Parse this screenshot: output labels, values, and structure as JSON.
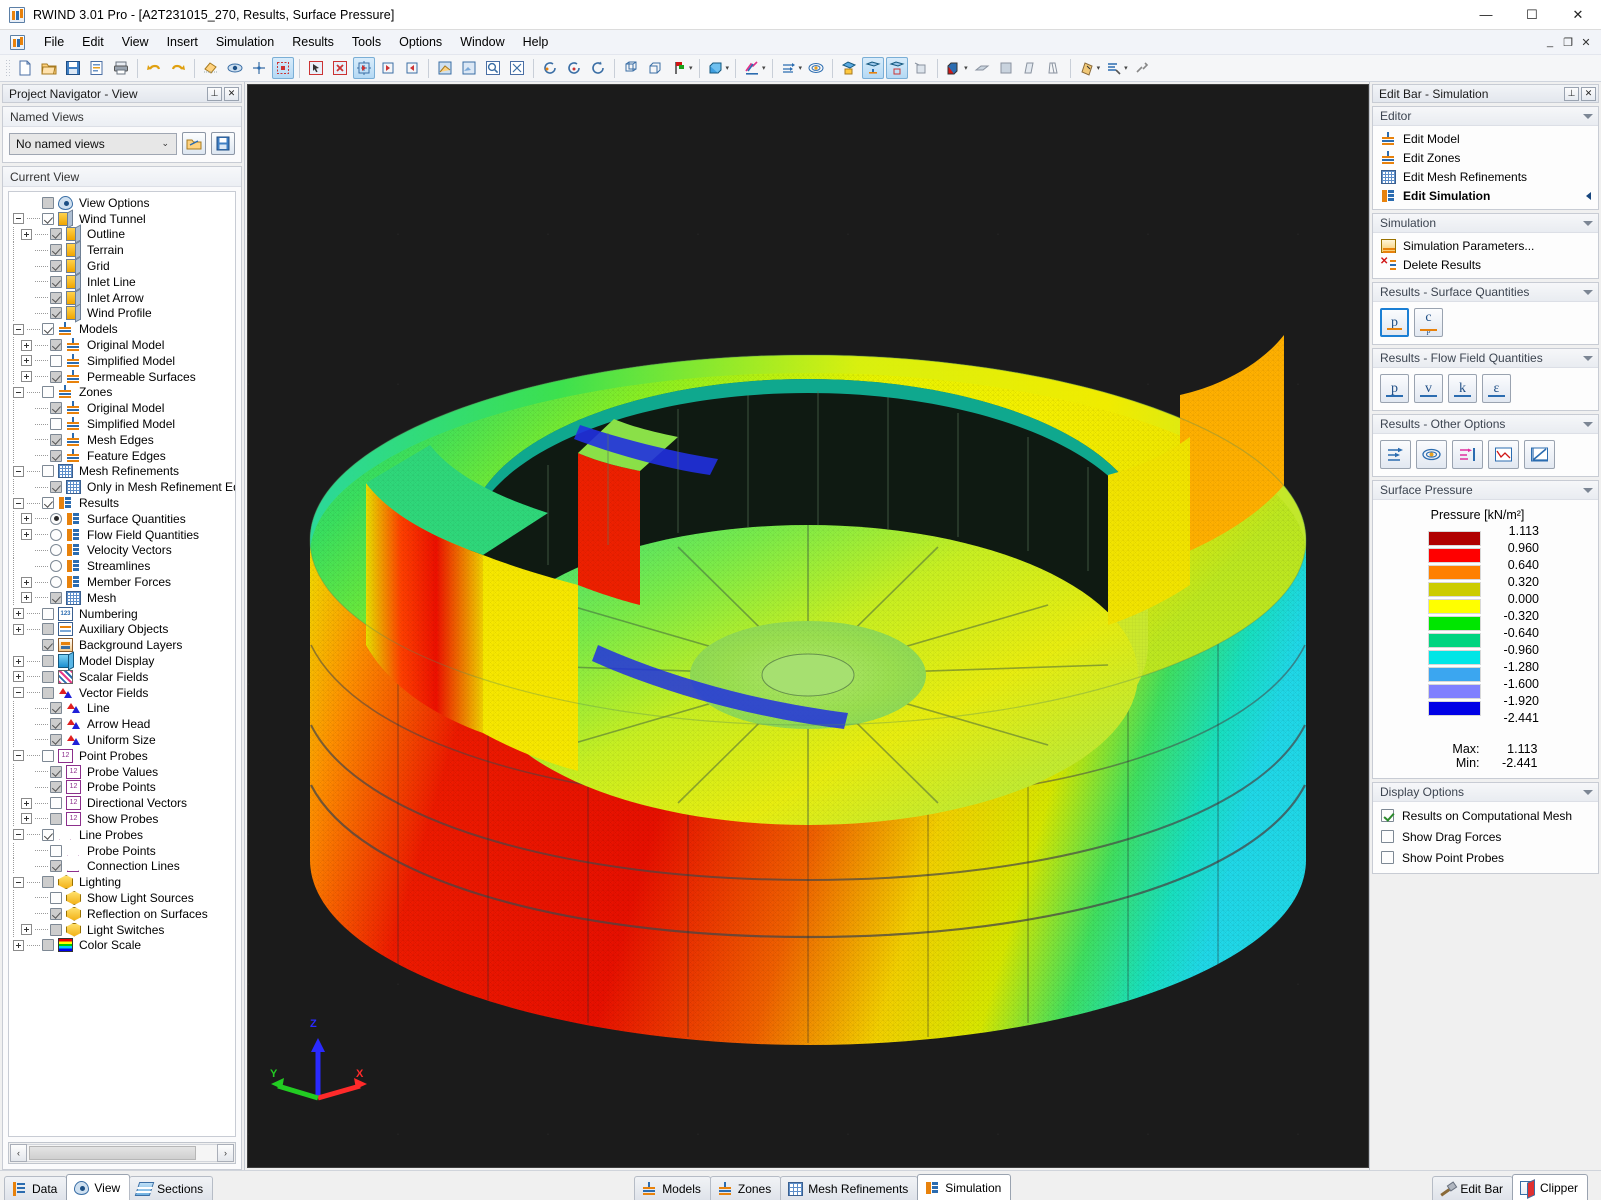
{
  "window": {
    "title": "RWIND 3.01 Pro - [A2T231015_270, Results, Surface Pressure]",
    "minimize": "—",
    "maximize": "☐",
    "close": "✕",
    "mdi_restore": "❐",
    "mdi_minimize": "_",
    "mdi_close": "✕"
  },
  "menu": {
    "items": [
      "File",
      "Edit",
      "View",
      "Insert",
      "Simulation",
      "Results",
      "Tools",
      "Options",
      "Window",
      "Help"
    ]
  },
  "toolbar": {
    "groups": [
      [
        "new-file-icon",
        "open-folder-icon",
        "save-icon",
        "print-preview-icon",
        "print-icon"
      ],
      [
        "undo-icon",
        "redo-icon"
      ],
      [
        "render-mode-icon",
        "view-eye-icon",
        "snap-grid-icon",
        "selection-box-icon"
      ],
      [
        "select-pointer-icon",
        "deselect-icon",
        "rotate-view-icon",
        "rotate-view-2-icon",
        "rotate-view-3-icon"
      ],
      [
        "pan-icon",
        "zoom-window-icon",
        "zoom-region-icon",
        "zoom-fit-icon",
        "zoom-all-icon"
      ],
      [
        "rotate-left-icon",
        "rotate-right-icon",
        "refresh-icon"
      ],
      [
        "wireframe-icon",
        "perspective-icon",
        "axes-flag-icon"
      ],
      [
        "box-view-icon"
      ],
      [
        "scalar-field-icon"
      ],
      [
        "vector-arrows-icon",
        "streamline-icon"
      ],
      [
        "result-surface-icon",
        "result-model-icon",
        "result-box-icon",
        "result-dim-icon"
      ],
      [
        "color-cube-icon",
        "plane-icon",
        "solid-icon",
        "section-icon",
        "clip-icon"
      ],
      [
        "measure-icon",
        "tools-icon",
        "settings-icon"
      ]
    ]
  },
  "left_panel": {
    "caption": "Project Navigator - View",
    "pin_glyph": "⊥",
    "close_glyph": "✕",
    "named_views": {
      "header": "Named Views",
      "selected": "No named views",
      "chevron": "⌄",
      "buttons": [
        "manage-views-icon",
        "save-view-icon"
      ]
    },
    "current_view": {
      "header": "Current View"
    },
    "tree": [
      {
        "depth": 0,
        "label": "View Options",
        "expander": "none",
        "box": "square-gray",
        "icon": "eye-icon"
      },
      {
        "depth": 0,
        "label": "Wind Tunnel",
        "expander": "minus",
        "box": "checked",
        "icon": "cube-icon"
      },
      {
        "depth": 1,
        "label": "Outline",
        "expander": "plus",
        "box": "checked-gray",
        "icon": "cube-icon"
      },
      {
        "depth": 1,
        "label": "Terrain",
        "expander": "none",
        "box": "checked-gray",
        "icon": "cube-icon"
      },
      {
        "depth": 1,
        "label": "Grid",
        "expander": "none",
        "box": "checked-gray",
        "icon": "cube-icon"
      },
      {
        "depth": 1,
        "label": "Inlet Line",
        "expander": "none",
        "box": "checked-gray",
        "icon": "cube-icon"
      },
      {
        "depth": 1,
        "label": "Inlet Arrow",
        "expander": "none",
        "box": "checked-gray",
        "icon": "cube-icon"
      },
      {
        "depth": 1,
        "label": "Wind Profile",
        "expander": "none",
        "box": "checked-gray",
        "icon": "cube-icon"
      },
      {
        "depth": 0,
        "label": "Models",
        "expander": "minus",
        "box": "checked",
        "icon": "support-icon"
      },
      {
        "depth": 1,
        "label": "Original Model",
        "expander": "plus",
        "box": "checked-gray",
        "icon": "support-icon"
      },
      {
        "depth": 1,
        "label": "Simplified Model",
        "expander": "plus",
        "box": "unchecked",
        "icon": "support-icon"
      },
      {
        "depth": 1,
        "label": "Permeable Surfaces",
        "expander": "plus",
        "box": "checked-gray",
        "icon": "support-icon"
      },
      {
        "depth": 0,
        "label": "Zones",
        "expander": "minus",
        "box": "unchecked",
        "icon": "support-icon"
      },
      {
        "depth": 1,
        "label": "Original Model",
        "expander": "none",
        "box": "checked-gray",
        "icon": "support-icon"
      },
      {
        "depth": 1,
        "label": "Simplified Model",
        "expander": "none",
        "box": "unchecked",
        "icon": "support-icon"
      },
      {
        "depth": 1,
        "label": "Mesh Edges",
        "expander": "none",
        "box": "checked-gray",
        "icon": "support-icon"
      },
      {
        "depth": 1,
        "label": "Feature Edges",
        "expander": "none",
        "box": "checked-gray",
        "icon": "support-icon"
      },
      {
        "depth": 0,
        "label": "Mesh Refinements",
        "expander": "minus",
        "box": "unchecked",
        "icon": "grid-icon"
      },
      {
        "depth": 1,
        "label": "Only in Mesh Refinement Edito",
        "expander": "none",
        "box": "checked-gray",
        "icon": "grid-icon"
      },
      {
        "depth": 0,
        "label": "Results",
        "expander": "minus",
        "box": "checked",
        "icon": "results-icon"
      },
      {
        "depth": 1,
        "label": "Surface Quantities",
        "expander": "plus",
        "box": "radio-on",
        "icon": "results-icon"
      },
      {
        "depth": 1,
        "label": "Flow Field Quantities",
        "expander": "plus",
        "box": "radio-off",
        "icon": "results-icon"
      },
      {
        "depth": 1,
        "label": "Velocity Vectors",
        "expander": "none",
        "box": "radio-off",
        "icon": "results-icon"
      },
      {
        "depth": 1,
        "label": "Streamlines",
        "expander": "none",
        "box": "radio-off",
        "icon": "results-icon"
      },
      {
        "depth": 1,
        "label": "Member Forces",
        "expander": "plus",
        "box": "radio-off",
        "icon": "results-icon"
      },
      {
        "depth": 1,
        "label": "Mesh",
        "expander": "plus",
        "box": "checked-gray",
        "icon": "grid-icon"
      },
      {
        "depth": 0,
        "label": "Numbering",
        "expander": "plus",
        "box": "unchecked",
        "icon": "numbering-icon"
      },
      {
        "depth": 0,
        "label": "Auxiliary Objects",
        "expander": "plus",
        "box": "square-gray",
        "icon": "aux-icon"
      },
      {
        "depth": 0,
        "label": "Background Layers",
        "expander": "none",
        "box": "checked-gray",
        "icon": "layers-icon"
      },
      {
        "depth": 0,
        "label": "Model Display",
        "expander": "plus",
        "box": "square-gray",
        "icon": "model3d-icon"
      },
      {
        "depth": 0,
        "label": "Scalar Fields",
        "expander": "plus",
        "box": "square-gray",
        "icon": "scalar-icon"
      },
      {
        "depth": 0,
        "label": "Vector Fields",
        "expander": "minus",
        "box": "square-gray",
        "icon": "vector-icon"
      },
      {
        "depth": 1,
        "label": "Line",
        "expander": "none",
        "box": "checked-gray",
        "icon": "vector-icon"
      },
      {
        "depth": 1,
        "label": "Arrow Head",
        "expander": "none",
        "box": "checked-gray",
        "icon": "vector-icon"
      },
      {
        "depth": 1,
        "label": "Uniform Size",
        "expander": "none",
        "box": "checked-gray",
        "icon": "vector-icon"
      },
      {
        "depth": 0,
        "label": "Point Probes",
        "expander": "minus",
        "box": "unchecked",
        "icon": "probe12-icon"
      },
      {
        "depth": 1,
        "label": "Probe Values",
        "expander": "none",
        "box": "checked-gray",
        "icon": "probe12-icon"
      },
      {
        "depth": 1,
        "label": "Probe Points",
        "expander": "none",
        "box": "checked-gray",
        "icon": "probe12-icon"
      },
      {
        "depth": 1,
        "label": "Directional Vectors",
        "expander": "plus",
        "box": "unchecked",
        "icon": "probe12-icon"
      },
      {
        "depth": 1,
        "label": "Show Probes",
        "expander": "plus",
        "box": "square-gray",
        "icon": "probe12-icon"
      },
      {
        "depth": 0,
        "label": "Line Probes",
        "expander": "minus",
        "box": "checked",
        "icon": "lineprobe-icon"
      },
      {
        "depth": 1,
        "label": "Probe Points",
        "expander": "none",
        "box": "unchecked",
        "icon": "lineprobe-icon"
      },
      {
        "depth": 1,
        "label": "Connection Lines",
        "expander": "none",
        "box": "checked-gray",
        "icon": "lineprobe-icon"
      },
      {
        "depth": 0,
        "label": "Lighting",
        "expander": "minus",
        "box": "square-gray",
        "icon": "light-icon"
      },
      {
        "depth": 1,
        "label": "Show Light Sources",
        "expander": "none",
        "box": "unchecked",
        "icon": "light-icon"
      },
      {
        "depth": 1,
        "label": "Reflection on Surfaces",
        "expander": "none",
        "box": "checked-gray",
        "icon": "light-icon"
      },
      {
        "depth": 1,
        "label": "Light Switches",
        "expander": "plus",
        "box": "square-gray",
        "icon": "light-icon"
      },
      {
        "depth": 0,
        "label": "Color Scale",
        "expander": "plus",
        "box": "square-gray",
        "icon": "colorscale-icon"
      }
    ],
    "scroll": {
      "left_glyph": "‹",
      "right_glyph": "›"
    }
  },
  "viewport": {
    "axes": {
      "x": "X",
      "y": "Y",
      "z": "Z",
      "x_color": "#ff2a2a",
      "y_color": "#22cc22",
      "z_color": "#2a2aff"
    },
    "background": "#1b1b1b"
  },
  "right_panel": {
    "caption": "Edit Bar - Simulation",
    "pin_glyph": "⊥",
    "close_glyph": "✕",
    "editor": {
      "header": "Editor",
      "items": [
        {
          "label": "Edit Model",
          "icon": "support-icon",
          "selected": false
        },
        {
          "label": "Edit Zones",
          "icon": "support-icon",
          "selected": false
        },
        {
          "label": "Edit Mesh Refinements",
          "icon": "grid-icon",
          "selected": false
        },
        {
          "label": "Edit Simulation",
          "icon": "results-icon",
          "selected": true
        }
      ]
    },
    "simulation": {
      "header": "Simulation",
      "items": [
        {
          "label": "Simulation Parameters...",
          "icon": "sim-params-icon"
        },
        {
          "label": "Delete Results",
          "icon": "delete-results-icon"
        }
      ]
    },
    "surface_quantities": {
      "header": "Results - Surface Quantities",
      "buttons": [
        {
          "label": "p",
          "sub": "",
          "name": "pressure-button",
          "active": true,
          "underline": "#e8820c"
        },
        {
          "label": "c",
          "sub": "p",
          "name": "cp-button",
          "active": false,
          "underline": "#e8820c"
        }
      ]
    },
    "flow_field_quantities": {
      "header": "Results - Flow Field Quantities",
      "buttons": [
        {
          "label": "p",
          "name": "flow-pressure-button",
          "underline": "#2b6cb0"
        },
        {
          "label": "v",
          "name": "velocity-button",
          "underline": "#2b6cb0"
        },
        {
          "label": "k",
          "name": "turbulence-k-button",
          "underline": "#2b6cb0"
        },
        {
          "label": "ε",
          "name": "turbulence-eps-button",
          "underline": "#2b6cb0"
        }
      ]
    },
    "other_options": {
      "header": "Results - Other Options",
      "buttons": [
        "velocity-vectors-icon",
        "streamlines-icon",
        "section-results-icon",
        "result-diagram-icon",
        "result-chart-icon"
      ]
    },
    "surface_pressure": {
      "header": "Surface Pressure",
      "legend_title": "Pressure [kN/m²]",
      "entries": [
        {
          "color": "#b00000",
          "value": "1.113"
        },
        {
          "color": "#ff0000",
          "value": "0.960"
        },
        {
          "color": "#ff8000",
          "value": "0.640"
        },
        {
          "color": "#cccc00",
          "value": "0.320"
        },
        {
          "color": "#ffff00",
          "value": "0.000"
        },
        {
          "color": "#00e600",
          "value": "-0.320"
        },
        {
          "color": "#00d480",
          "value": "-0.640"
        },
        {
          "color": "#00e6e6",
          "value": "-0.960"
        },
        {
          "color": "#3ba6f0",
          "value": "-1.280"
        },
        {
          "color": "#8080ff",
          "value": "-1.600"
        },
        {
          "color": "#0000e6",
          "value": "-1.920"
        },
        {
          "color": "",
          "value": "-2.441"
        }
      ],
      "max_label": "Max:",
      "max_value": "1.113",
      "min_label": "Min:",
      "min_value": "-2.441"
    },
    "display_options": {
      "header": "Display Options",
      "items": [
        {
          "label": "Results on Computational Mesh",
          "checked": true
        },
        {
          "label": "Show Drag Forces",
          "checked": false
        },
        {
          "label": "Show Point Probes",
          "checked": false
        }
      ]
    }
  },
  "bottom": {
    "left_tabs": [
      {
        "label": "Data",
        "icon": "data-icon",
        "active": false
      },
      {
        "label": "View",
        "icon": "eye-icon",
        "active": true
      },
      {
        "label": "Sections",
        "icon": "sections-icon",
        "active": false
      }
    ],
    "center_tabs": [
      {
        "label": "Models",
        "icon": "support-icon",
        "active": false
      },
      {
        "label": "Zones",
        "icon": "support-icon",
        "active": false
      },
      {
        "label": "Mesh Refinements",
        "icon": "meshref-icon",
        "active": false
      },
      {
        "label": "Simulation",
        "icon": "results-icon",
        "active": true
      }
    ],
    "right_tabs": [
      {
        "label": "Edit Bar",
        "icon": "editbar-icon",
        "active": false
      },
      {
        "label": "Clipper",
        "icon": "clipper-icon",
        "active": true
      }
    ]
  },
  "chart_data": {
    "type": "heatmap",
    "title": "Surface Pressure",
    "ylabel": "Pressure [kN/m²]",
    "legend_position": "right",
    "categories": [
      "1.113",
      "0.960",
      "0.640",
      "0.320",
      "0.000",
      "-0.320",
      "-0.640",
      "-0.960",
      "-1.280",
      "-1.600",
      "-1.920",
      "-2.441"
    ],
    "values": [
      1.113,
      0.96,
      0.64,
      0.32,
      0.0,
      -0.32,
      -0.64,
      -0.96,
      -1.28,
      -1.6,
      -1.92,
      -2.441
    ],
    "colors": [
      "#b00000",
      "#ff0000",
      "#ff8000",
      "#cccc00",
      "#ffff00",
      "#00e600",
      "#00d480",
      "#00e6e6",
      "#3ba6f0",
      "#8080ff",
      "#0000e6"
    ],
    "zlim": [
      -2.441,
      1.113
    ],
    "max": 1.113,
    "min": -2.441,
    "units": "kN/m²"
  }
}
